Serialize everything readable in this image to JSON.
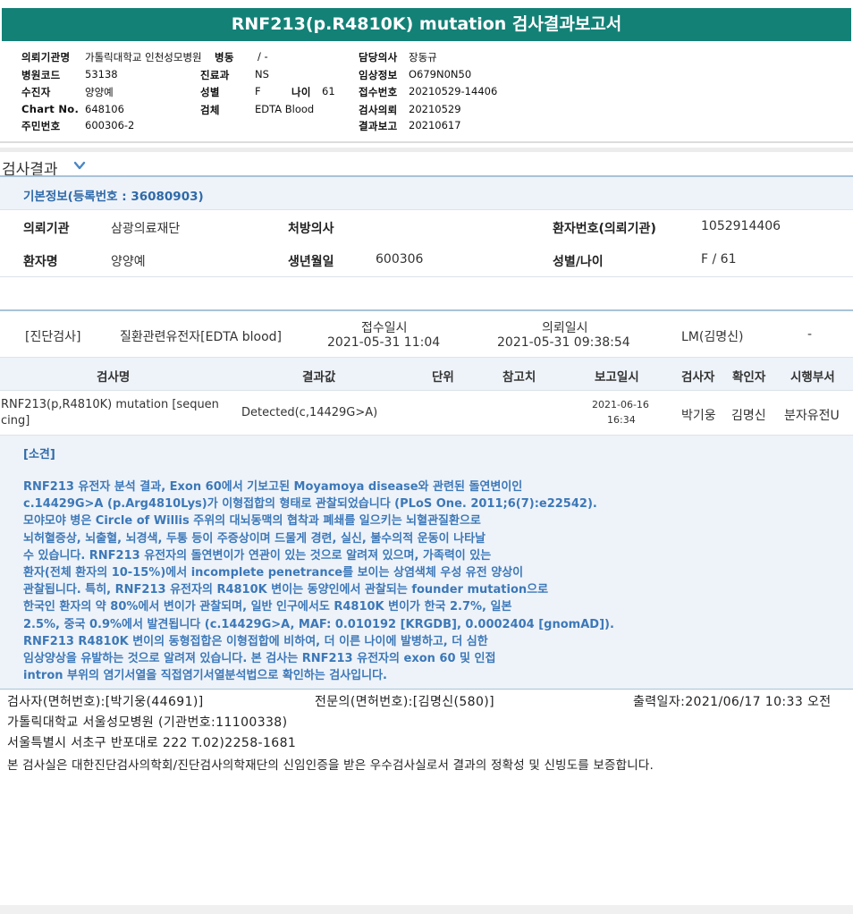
{
  "report_title": "RNF213(p.R4810K) mutation 검사결과보고서",
  "header": {
    "left": [
      {
        "label": "의뢰기관명",
        "value": "가톨릭대학교 인천성모병원"
      },
      {
        "label": "병원코드",
        "value": "53138"
      },
      {
        "label": "수진자",
        "value": "양양예"
      },
      {
        "label": "Chart No.",
        "value": "648106"
      },
      {
        "label": "주민번호",
        "value": "600306-2"
      }
    ],
    "mid": [
      {
        "label": "병동",
        "value": "/ -"
      },
      {
        "label": "진료과",
        "value": "NS"
      },
      {
        "label": "성별",
        "value": "F"
      },
      {
        "label": "검체",
        "value": "EDTA Blood"
      }
    ],
    "age": {
      "label": "나이",
      "value": "61"
    },
    "right": [
      {
        "label": "담당의사",
        "value": "장동규"
      },
      {
        "label": "임상정보",
        "value": "O679N0N50"
      },
      {
        "label": "접수번호",
        "value": "20210529-14406"
      },
      {
        "label": "검사의뢰",
        "value": "20210529"
      },
      {
        "label": "결과보고",
        "value": "20210617"
      }
    ]
  },
  "section_title": "검사결과",
  "basic_info": {
    "title": "기본정보(등록번호 : 36080903)",
    "row1": {
      "l1": "의뢰기관",
      "v1": "삼광의료재단",
      "l2": "처방의사",
      "v2": "",
      "l3": "환자번호(의뢰기관)",
      "v3": "1052914406"
    },
    "row2": {
      "l1": "환자명",
      "v1": "양양예",
      "l2": "생년월일",
      "v2": "600306",
      "l3": "성별/나이",
      "v3": "F / 61"
    }
  },
  "order": {
    "category": "[진단검사]",
    "name": "질환관련유전자[EDTA blood]",
    "received_label": "접수일시",
    "received": "2021-05-31 11:04",
    "requested_label": "의뢰일시",
    "requested": "2021-05-31 09:38:54",
    "doctor": "LM(김명신)",
    "dash": "-"
  },
  "table": {
    "headers": {
      "name": "검사명",
      "result": "결과값",
      "unit": "단위",
      "ref": "참고치",
      "report": "보고일시",
      "tester": "검사자",
      "confirmer": "확인자",
      "dept": "시행부서"
    },
    "row": {
      "name_line1": "RNF213(p,R4810K) mutation [sequen",
      "name_line2": "cing]",
      "result": "Detected(c,14429G>A)",
      "report_date": "2021-06-16",
      "report_time": "16:34",
      "tester": "박기웅",
      "confirmer": "김명신",
      "dept": "분자유전U"
    }
  },
  "opinion": {
    "title": "[소견]",
    "lines": [
      "RNF213 유전자 분석 결과, Exon 60에서 기보고된 Moyamoya disease와 관련된 돌연변이인",
      "c.14429G>A (p.Arg4810Lys)가 이형접합의 형태로 관찰되었습니다 (PLoS One. 2011;6(7):e22542).",
      "모야모야 병은 Circle of Willis 주위의 대뇌동맥의 협착과 폐쇄를 일으키는 뇌혈관질환으로",
      "뇌허혈증상, 뇌출혈, 뇌경색, 두통 등이 주증상이며 드물게 경련, 실신, 불수의적 운동이 나타날",
      "수 있습니다. RNF213 유전자의 돌연변이가 연관이 있는 것으로 알려져 있으며, 가족력이 있는",
      "환자(전체 환자의 10-15%)에서 incomplete penetrance를 보이는 상염색체 우성 유전 양상이",
      "관찰됩니다. 특히, RNF213 유전자의 R4810K 변이는 동양인에서 관찰되는 founder mutation으로",
      "한국인 환자의 약 80%에서 변이가 관찰되며, 일반 인구에서도 R4810K 변이가 한국 2.7%, 일본",
      "2.5%, 중국 0.9%에서 발견됩니다 (c.14429G>A, MAF: 0.010192 [KRGDB], 0.0002404 [gnomAD]).",
      "RNF213 R4810K 변이의 동형접합은 이형접합에 비하여, 더 이른 나이에 발병하고, 더 심한",
      "임상양상을 유발하는 것으로 알려져 있습니다. 본 검사는 RNF213 유전자의 exon 60 및 인접",
      "intron 부위의 염기서열을 직접염기서열분석법으로 확인하는 검사입니다."
    ]
  },
  "footer": {
    "tester": "검사자(면허번호):[박기웅(44691)]",
    "specialist": "전문의(면허번호):[김명신(580)]",
    "printed": "출력일자:2021/06/17 10:33 오전",
    "hospital": "가톨릭대학교 서울성모병원 (기관번호:11100338)",
    "address": "서울특별시 서초구 반포대로 222 T.02)2258-1681",
    "certification": "본 검사실은 대한진단검사의학회/진단검사의학재단의 신임인증을 받은 우수검사실로서 결과의 정확성 및 신빙도를 보증합니다."
  }
}
